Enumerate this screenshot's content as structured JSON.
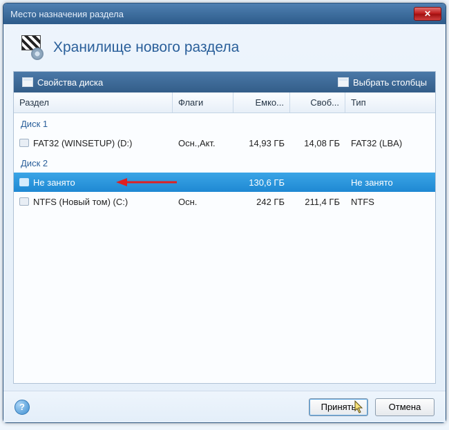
{
  "window": {
    "title": "Место назначения раздела",
    "close_glyph": "✕"
  },
  "header": {
    "title": "Хранилище нового раздела"
  },
  "toolbar": {
    "disk_properties": "Свойства диска",
    "choose_columns": "Выбрать столбцы"
  },
  "columns": {
    "partition": "Раздел",
    "flags": "Флаги",
    "capacity": "Емко...",
    "free": "Своб...",
    "type": "Тип"
  },
  "disks": [
    {
      "label": "Диск 1",
      "rows": [
        {
          "selected": false,
          "partition": "FAT32 (WINSETUP) (D:)",
          "flags": "Осн.,Акт.",
          "capacity": "14,93 ГБ",
          "free": "14,08 ГБ",
          "type": "FAT32 (LBA)"
        }
      ]
    },
    {
      "label": "Диск 2",
      "rows": [
        {
          "selected": true,
          "partition": "Не занято",
          "flags": "",
          "capacity": "130,6 ГБ",
          "free": "",
          "type": "Не занято"
        },
        {
          "selected": false,
          "partition": "NTFS (Новый том) (C:)",
          "flags": "Осн.",
          "capacity": "242 ГБ",
          "free": "211,4 ГБ",
          "type": "NTFS"
        }
      ]
    }
  ],
  "footer": {
    "help_glyph": "?",
    "accept": "Принять",
    "cancel": "Отмена"
  },
  "annotation": {
    "arrow_color": "#e02020"
  }
}
